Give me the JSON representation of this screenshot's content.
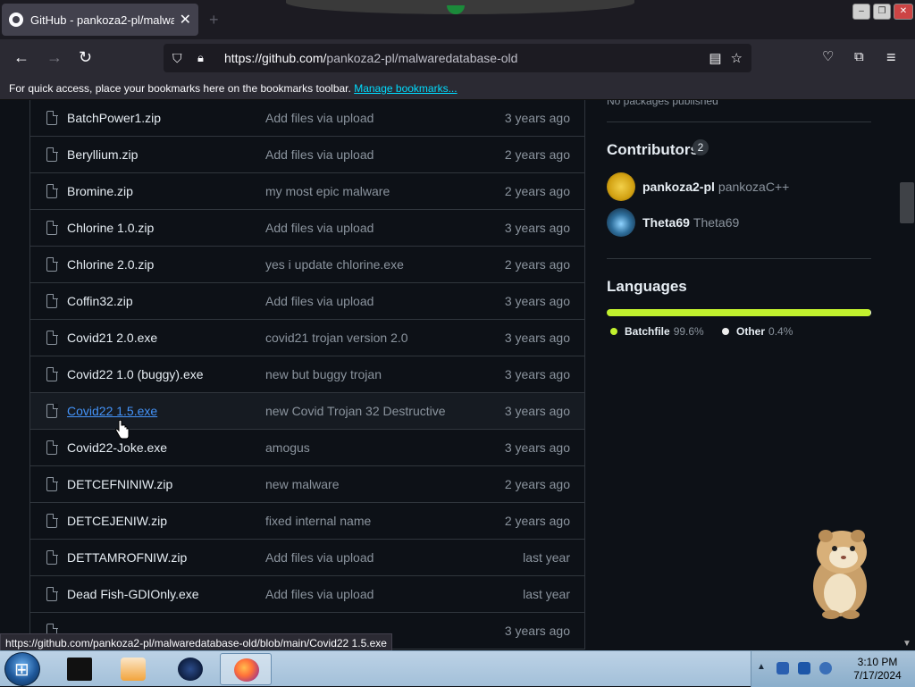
{
  "browser": {
    "tab_title": "GitHub - pankoza2-pl/malwaredatabase-old",
    "tab_close": "✕",
    "new_tab": "+",
    "url_host": "https://github.com/",
    "url_path": "pankoza2-pl/malwaredatabase-old",
    "bookmarks_text": "For quick access, place your bookmarks here on the bookmarks toolbar.",
    "bookmarks_link": "Manage bookmarks...",
    "status_url": "https://github.com/pankoza2-pl/malwaredatabase-old/blob/main/Covid22 1.5.exe"
  },
  "files": [
    {
      "name": "BatchPower1.zip",
      "message": "Add files via upload",
      "date": "3 years ago"
    },
    {
      "name": "Beryllium.zip",
      "message": "Add files via upload",
      "date": "2 years ago"
    },
    {
      "name": "Bromine.zip",
      "message": "my most epic malware",
      "date": "2 years ago"
    },
    {
      "name": "Chlorine 1.0.zip",
      "message": "Add files via upload",
      "date": "3 years ago"
    },
    {
      "name": "Chlorine 2.0.zip",
      "message": "yes i update chlorine.exe",
      "date": "2 years ago"
    },
    {
      "name": "Coffin32.zip",
      "message": "Add files via upload",
      "date": "3 years ago"
    },
    {
      "name": "Covid21 2.0.exe",
      "message": "covid21 trojan version 2.0",
      "date": "3 years ago"
    },
    {
      "name": "Covid22 1.0 (buggy).exe",
      "message": "new but buggy trojan",
      "date": "3 years ago"
    },
    {
      "name": "Covid22 1.5.exe",
      "message": "new Covid Trojan 32 Destructive",
      "date": "3 years ago"
    },
    {
      "name": "Covid22-Joke.exe",
      "message": "amogus",
      "date": "3 years ago"
    },
    {
      "name": "DETCEFNINIW.zip",
      "message": "new malware",
      "date": "2 years ago"
    },
    {
      "name": "DETCEJENIW.zip",
      "message": "fixed internal name",
      "date": "2 years ago"
    },
    {
      "name": "DETTAMROFNIW.zip",
      "message": "Add files via upload",
      "date": "last year"
    },
    {
      "name": "Dead Fish-GDIOnly.exe",
      "message": "Add files via upload",
      "date": "last year"
    },
    {
      "name": "",
      "message": "",
      "date": "3 years ago"
    }
  ],
  "sidebar": {
    "packages_text": "No packages published",
    "contributors_title": "Contributors",
    "contributors_count": "2",
    "contributors": [
      {
        "login": "pankoza2-pl",
        "display": "pankozaC++"
      },
      {
        "login": "Theta69",
        "display": "Theta69"
      }
    ],
    "languages_title": "Languages",
    "languages": [
      {
        "name": "Batchfile",
        "percent": "99.6%",
        "value": 99.6,
        "color": "#c1f12e"
      },
      {
        "name": "Other",
        "percent": "0.4%",
        "value": 0.4,
        "color": "#ededed"
      }
    ]
  },
  "taskbar": {
    "time": "3:10 PM",
    "date": "7/17/2024"
  }
}
